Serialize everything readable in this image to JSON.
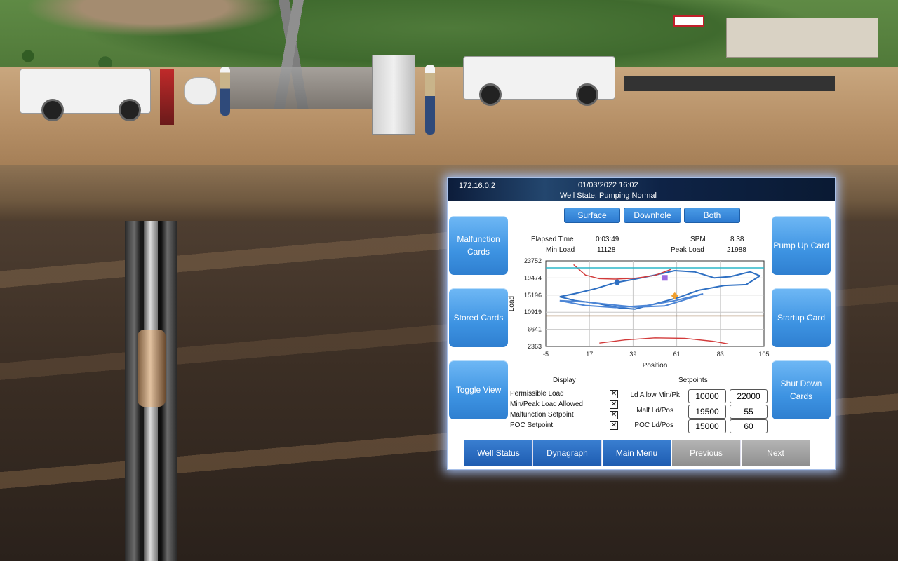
{
  "hmi": {
    "ip": "172.16.0.2",
    "datetime": "01/03/2022 16:02",
    "well_state": "Well State: Pumping Normal",
    "left_buttons": [
      "Malfunction Cards",
      "Stored Cards",
      "Toggle View"
    ],
    "right_buttons": [
      "Pump Up Card",
      "Startup Card",
      "Shut Down Cards"
    ],
    "view_buttons": [
      "Surface",
      "Downhole",
      "Both"
    ],
    "stats": {
      "elapsed_time_label": "Elapsed Time",
      "elapsed_time": "0:03:49",
      "spm_label": "SPM",
      "spm": "8.38",
      "min_load_label": "Min Load",
      "min_load": "11128",
      "peak_load_label": "Peak Load",
      "peak_load": "21988"
    },
    "display": {
      "title": "Display",
      "items": [
        "Permissible Load",
        "Min/Peak Load Allowed",
        "Malfunction Setpoint",
        "POC Setpoint"
      ],
      "checked": [
        true,
        true,
        true,
        true
      ]
    },
    "setpoints": {
      "title": "Setpoints",
      "rows": [
        {
          "label": "Ld Allow Min/Pk",
          "v1": "10000",
          "v2": "22000"
        },
        {
          "label": "Malf Ld/Pos",
          "v1": "19500",
          "v2": "55"
        },
        {
          "label": "POC Ld/Pos",
          "v1": "15000",
          "v2": "60"
        }
      ]
    },
    "nav": [
      "Well Status",
      "Dynagraph",
      "Main Menu",
      "Previous",
      "Next"
    ],
    "colors": {
      "accent_blue": "#2d7ad0",
      "nav_grey": "#9e9e9e",
      "surface_series": "#2e6fc2",
      "limit_red": "#d23a3a"
    }
  },
  "chart_data": {
    "type": "line",
    "xlabel": "Position",
    "ylabel": "Load",
    "xlim": [
      -5,
      105
    ],
    "ylim": [
      2363,
      23752
    ],
    "xticks": [
      "-5",
      "17",
      "39",
      "61",
      "83",
      "105"
    ],
    "yticks": [
      "23752",
      "19474",
      "15196",
      "10919",
      "6641",
      "2363"
    ],
    "grid": true,
    "series": [
      {
        "role": "surface card",
        "color": "#2e6fc2",
        "points": [
          [
            2,
            14800
          ],
          [
            10,
            15600
          ],
          [
            20,
            16800
          ],
          [
            30,
            18300
          ],
          [
            40,
            19200
          ],
          [
            50,
            20200
          ],
          [
            60,
            21300
          ],
          [
            70,
            21000
          ],
          [
            80,
            19500
          ],
          [
            88,
            19800
          ],
          [
            98,
            21000
          ],
          [
            103,
            20000
          ],
          [
            96,
            17800
          ],
          [
            85,
            17600
          ],
          [
            72,
            16400
          ],
          [
            62,
            14600
          ],
          [
            50,
            13000
          ],
          [
            40,
            11700
          ],
          [
            32,
            12000
          ],
          [
            20,
            13200
          ],
          [
            10,
            13800
          ],
          [
            2,
            14800
          ]
        ]
      },
      {
        "role": "downhole card",
        "color": "#4d86d6",
        "points": [
          [
            2,
            13800
          ],
          [
            15,
            13500
          ],
          [
            28,
            12800
          ],
          [
            40,
            12200
          ],
          [
            55,
            12500
          ],
          [
            65,
            14000
          ],
          [
            74,
            15500
          ],
          [
            60,
            13800
          ],
          [
            46,
            12600
          ],
          [
            30,
            12100
          ],
          [
            15,
            12600
          ],
          [
            2,
            13800
          ]
        ]
      },
      {
        "role": "upper limit",
        "color": "#d23a3a",
        "points": [
          [
            9,
            22800
          ],
          [
            15,
            20200
          ],
          [
            22,
            19300
          ],
          [
            30,
            19200
          ],
          [
            40,
            19400
          ],
          [
            50,
            20100
          ],
          [
            58,
            21600
          ]
        ]
      },
      {
        "role": "lower limit",
        "color": "#d23a3a",
        "points": [
          [
            22,
            3200
          ],
          [
            35,
            4000
          ],
          [
            50,
            4500
          ],
          [
            65,
            4400
          ],
          [
            80,
            3600
          ],
          [
            87,
            3000
          ]
        ]
      },
      {
        "role": "upper horizontal line",
        "color": "#2bb7c9",
        "points": [
          [
            -5,
            22000
          ],
          [
            105,
            22000
          ]
        ]
      },
      {
        "role": "lower horizontal line",
        "color": "#8a5a2a",
        "points": [
          [
            -5,
            10000
          ],
          [
            105,
            10000
          ]
        ]
      }
    ],
    "markers": [
      {
        "shape": "circle",
        "color": "#2e6fc2",
        "x": 31,
        "y": 18400
      },
      {
        "shape": "square",
        "color": "#9b6ae0",
        "x": 55,
        "y": 19500
      },
      {
        "shape": "diamond",
        "color": "#f0a030",
        "x": 60,
        "y": 15000
      }
    ]
  }
}
